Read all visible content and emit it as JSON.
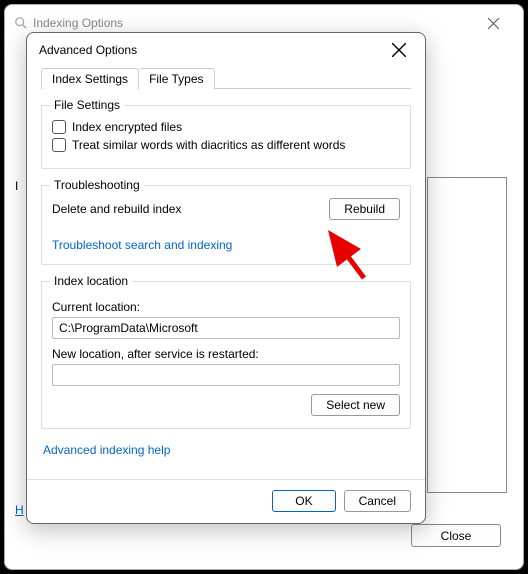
{
  "bg": {
    "title": "Indexing Options",
    "left_label": "I",
    "help_link_char": "H",
    "close_btn": "Close"
  },
  "dialog": {
    "title": "Advanced Options",
    "tabs": {
      "index_settings": "Index Settings",
      "file_types": "File Types"
    },
    "file_settings": {
      "legend": "File Settings",
      "opt_encrypted": "Index encrypted files",
      "opt_diacritics": "Treat similar words with diacritics as different words"
    },
    "troubleshooting": {
      "legend": "Troubleshooting",
      "rebuild_label": "Delete and rebuild index",
      "rebuild_btn": "Rebuild",
      "troubleshoot_link": "Troubleshoot search and indexing"
    },
    "index_location": {
      "legend": "Index location",
      "current_label": "Current location:",
      "current_value": "C:\\ProgramData\\Microsoft",
      "new_label": "New location, after service is restarted:",
      "new_value": "",
      "select_new_btn": "Select new"
    },
    "advanced_help_link": "Advanced indexing help",
    "ok_btn": "OK",
    "cancel_btn": "Cancel"
  }
}
